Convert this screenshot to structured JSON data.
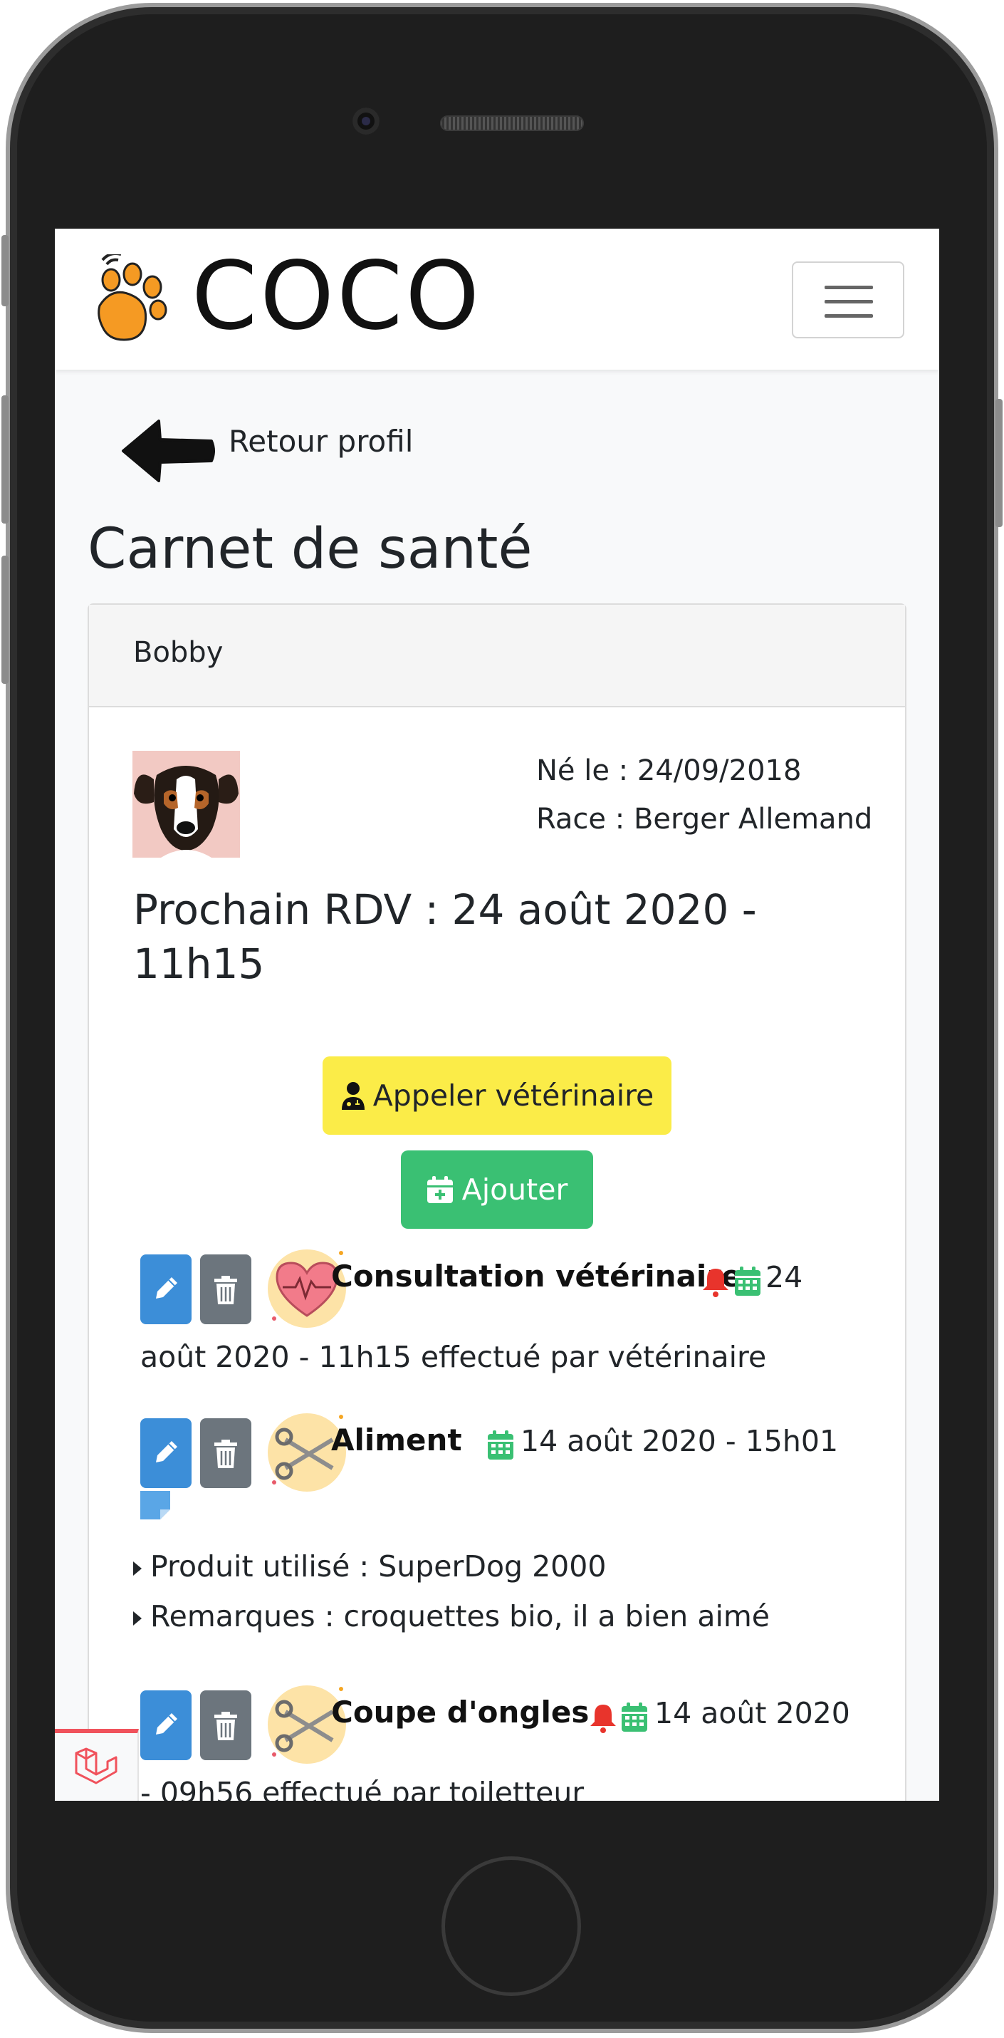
{
  "app": {
    "brand": "COCO"
  },
  "nav": {
    "back_label": "Retour profil"
  },
  "page": {
    "title": "Carnet de santé"
  },
  "pet": {
    "name": "Bobby",
    "birth_label": "Né le :",
    "birth_date": "24/09/2018",
    "breed_label": "Race :",
    "breed": "Berger Allemand",
    "next_appointment": "Prochain RDV : 24 août 2020 - 11h15"
  },
  "actions": {
    "call_vet": "Appeler vétérinaire",
    "add": "Ajouter"
  },
  "events": [
    {
      "title": "Consultation vétérinaire",
      "has_bell": true,
      "date_first": "24",
      "date_rest": "août 2020 - 11h15 effectué par vétérinaire",
      "icon": "heart-icon"
    },
    {
      "title": "Aliment",
      "has_bell": false,
      "date_first": "14 août 2020 - 15h01",
      "icon": "scissors-icon",
      "details": [
        "Produit utilisé : SuperDog 2000",
        "Remarques : croquettes bio, il a bien aimé"
      ]
    },
    {
      "title": "Coupe d'ongles",
      "has_bell": true,
      "date_first": "14 août 2020",
      "date_rest": "- 09h56 effectué par toiletteur",
      "icon": "scissors-icon"
    }
  ],
  "colors": {
    "paw": "#f59a23",
    "call_vet": "#fbec48",
    "add": "#3ac073",
    "edit": "#3c8ed8",
    "delete": "#6c757d",
    "bell": "#e8342c",
    "calendar": "#3ac073",
    "laravel": "#f0525c"
  }
}
